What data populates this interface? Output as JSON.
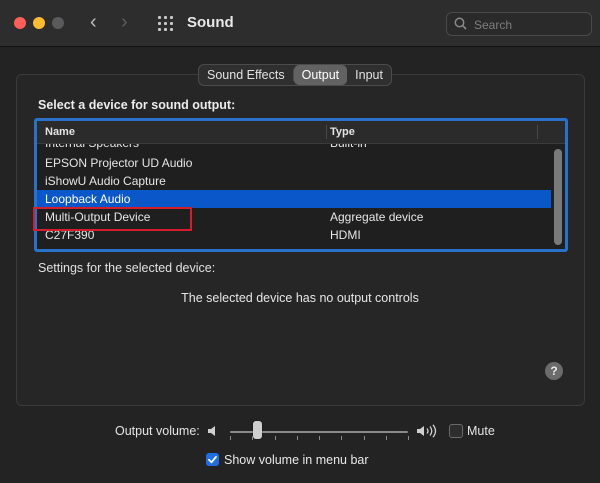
{
  "window": {
    "title": "Sound"
  },
  "toolbar": {
    "search_placeholder": "Search",
    "back_glyph": "‹",
    "forward_glyph": "›"
  },
  "tabs": [
    {
      "label": "Sound Effects",
      "active": false
    },
    {
      "label": "Output",
      "active": true
    },
    {
      "label": "Input",
      "active": false
    }
  ],
  "output": {
    "heading": "Select a device for sound output:",
    "columns": {
      "name": "Name",
      "type": "Type"
    },
    "devices": [
      {
        "name": "Internal Speakers",
        "type": "Built-in"
      },
      {
        "name": "EPSON Projector UD Audio",
        "type": ""
      },
      {
        "name": "iShowU Audio Capture",
        "type": ""
      },
      {
        "name": "Loopback Audio",
        "type": "",
        "selected": true
      },
      {
        "name": "Multi-Output Device",
        "type": "Aggregate device",
        "annotated": true
      },
      {
        "name": "C27F390",
        "type": "HDMI"
      }
    ],
    "settings_label": "Settings for the selected device:",
    "no_controls_text": "The selected device has no output controls",
    "help_glyph": "?"
  },
  "volume": {
    "label": "Output volume:",
    "level": 0.15,
    "mute_label": "Mute",
    "mute_checked": false,
    "show_in_menu_bar_label": "Show volume in menu bar",
    "show_in_menu_bar_checked": true
  },
  "colors": {
    "selection": "#0a57c9",
    "focus_ring": "#2a72c9",
    "annotation": "#d61d2c"
  },
  "icons": {
    "left_speaker": "speaker-low-icon",
    "right_speaker": "speaker-high-icon"
  }
}
